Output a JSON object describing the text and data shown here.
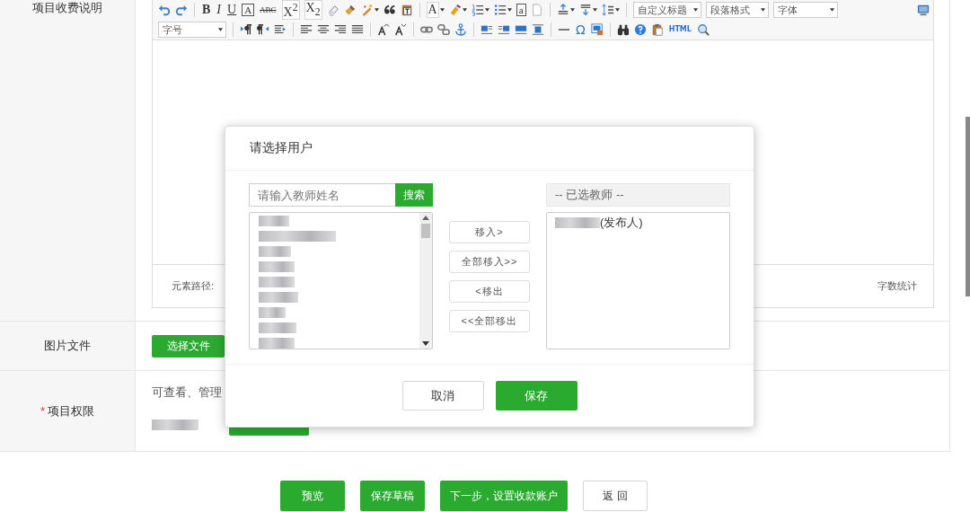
{
  "form": {
    "description": {
      "label": "项目收费说明",
      "required": false,
      "editor": {
        "glyphs": [
          {
            "label": "B",
            "kind": "bold"
          },
          {
            "label": "I",
            "kind": "italic"
          },
          {
            "label": "U",
            "kind": "underline"
          },
          {
            "label": "A",
            "kind": "boxed"
          },
          {
            "label": "ABC",
            "kind": "strike"
          },
          {
            "label": "X$^{2}$",
            "kind": "plain"
          },
          {
            "label": "X$_{2}$",
            "kind": "plain"
          },
          {
            "label": "A",
            "kind": "plain"
          },
          {
            "label": "a",
            "kind": "boxed"
          },
          {
            "label": "Ω",
            "kind": "accent"
          },
          {
            "label": "HTML",
            "kind": "tiny"
          }
        ],
        "selects": [
          {
            "value": "自定义标题"
          },
          {
            "value": "段落格式"
          },
          {
            "value": "字体"
          },
          {
            "value": "字号"
          }
        ],
        "path_label": "元素路径:",
        "word_count": "字数统计"
      }
    },
    "image": {
      "label": "图片文件",
      "required": false,
      "button": "选择文件"
    },
    "permission": {
      "label": "项目权限",
      "required": true,
      "required_mark": "*",
      "text": "可查看、管理"
    }
  },
  "actions": [
    {
      "label": "预览",
      "kind": "primary"
    },
    {
      "label": "保存草稿",
      "kind": "primary"
    },
    {
      "label": "下一步，设置收款账户",
      "kind": "primary"
    },
    {
      "label": "返 回",
      "kind": "default"
    }
  ],
  "dialog": {
    "title": "请选择用户",
    "search": {
      "placeholder": "请输入教师姓名",
      "button": "搜索"
    },
    "move_buttons": [
      "移入>",
      "全部移入>>",
      "<移出",
      "<<全部移出"
    ],
    "selected_header": "-- 已选教师 --",
    "selected": [
      {
        "suffix": "(发布人)"
      }
    ],
    "cancel": "取消",
    "save": "保存"
  }
}
